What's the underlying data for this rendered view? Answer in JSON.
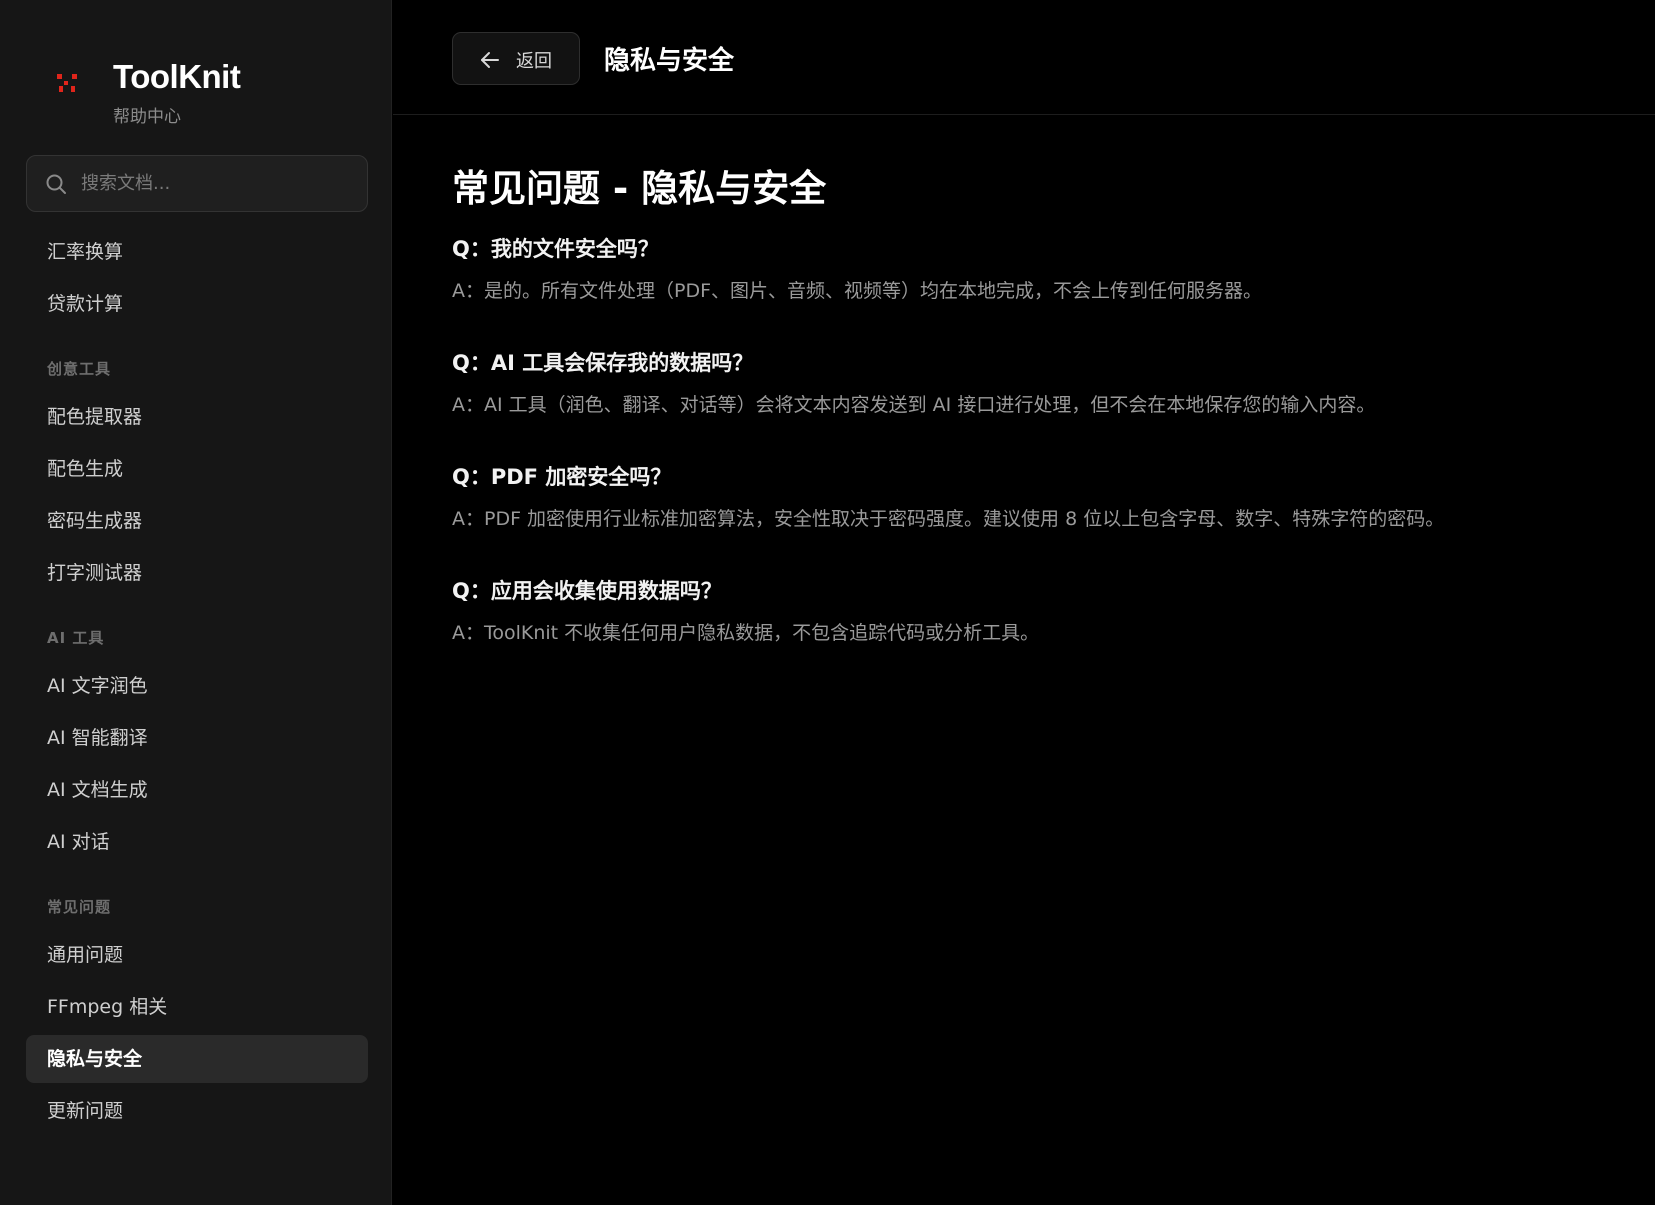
{
  "brand": {
    "name": "ToolKnit",
    "subtitle": "帮助中心"
  },
  "search": {
    "placeholder": "搜索文档..."
  },
  "sidebar": {
    "items_top": [
      {
        "label": "汇率换算"
      },
      {
        "label": "贷款计算"
      }
    ],
    "groups": [
      {
        "title": "创意工具",
        "items": [
          {
            "label": "配色提取器"
          },
          {
            "label": "配色生成"
          },
          {
            "label": "密码生成器"
          },
          {
            "label": "打字测试器"
          }
        ]
      },
      {
        "title": "AI 工具",
        "items": [
          {
            "label": "AI 文字润色"
          },
          {
            "label": "AI 智能翻译"
          },
          {
            "label": "AI 文档生成"
          },
          {
            "label": "AI 对话"
          }
        ]
      },
      {
        "title": "常见问题",
        "items": [
          {
            "label": "通用问题"
          },
          {
            "label": "FFmpeg 相关"
          },
          {
            "label": "隐私与安全",
            "active": true
          },
          {
            "label": "更新问题"
          }
        ]
      }
    ]
  },
  "topbar": {
    "back_label": "返回",
    "title": "隐私与安全"
  },
  "content": {
    "title": "常见问题 - 隐私与安全",
    "faqs": [
      {
        "q": "Q：我的文件安全吗？",
        "a": "A：是的。所有文件处理（PDF、图片、音频、视频等）均在本地完成，不会上传到任何服务器。"
      },
      {
        "q": "Q：AI 工具会保存我的数据吗？",
        "a": "A：AI 工具（润色、翻译、对话等）会将文本内容发送到 AI 接口进行处理，但不会在本地保存您的输入内容。"
      },
      {
        "q": "Q：PDF 加密安全吗？",
        "a": "A：PDF 加密使用行业标准加密算法，安全性取决于密码强度。建议使用 8 位以上包含字母、数字、特殊字符的密码。"
      },
      {
        "q": "Q：应用会收集使用数据吗？",
        "a": "A：ToolKnit 不收集任何用户隐私数据，不包含追踪代码或分析工具。"
      }
    ]
  },
  "colors": {
    "sidebar_bg": "#161616",
    "main_bg": "#000000",
    "active_item_bg": "#2a2a2a",
    "logo_accent": "#e0251b"
  }
}
